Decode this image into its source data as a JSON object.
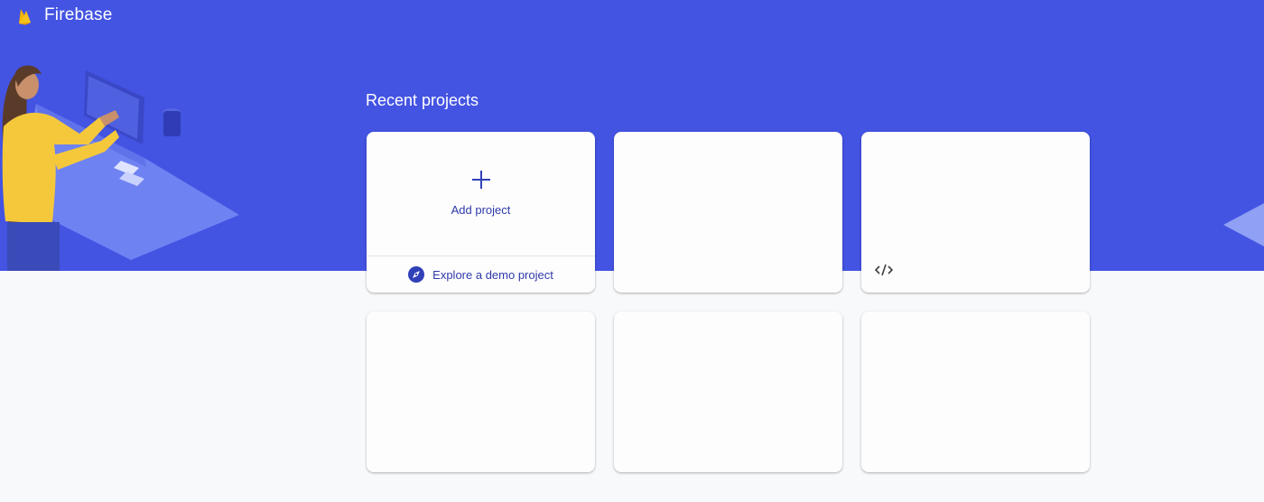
{
  "header": {
    "brand": "Firebase"
  },
  "main": {
    "section_title": "Recent projects",
    "add_project_label": "Add project",
    "demo_link_label": "Explore a demo project"
  },
  "icons": {
    "logo": "firebase-flame-icon",
    "add": "plus-icon",
    "demo": "compass-icon",
    "web_app": "code-icon"
  },
  "colors": {
    "hero_background": "#4353e2",
    "accent_text": "#2f3aa8",
    "page_background": "#f8f9fb",
    "card_background": "#fdfdfe"
  }
}
